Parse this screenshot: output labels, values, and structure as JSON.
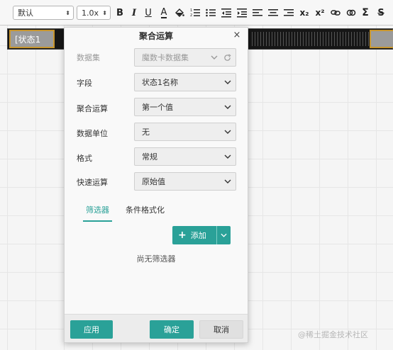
{
  "toolbar": {
    "font_value": "默认",
    "size_value": "1.0x",
    "buttons": [
      "bold",
      "italic",
      "underline",
      "font-color",
      "fill-color",
      "ordered-list",
      "unordered-list",
      "outdent",
      "indent",
      "align-left",
      "align-center",
      "align-right",
      "subscript",
      "superscript",
      "link",
      "sum",
      "strikethrough"
    ],
    "sub_label": "x₂",
    "sup_label": "x²",
    "sum_label": "Σ"
  },
  "cell": {
    "label": "[状态1"
  },
  "dialog": {
    "title": "聚合运算",
    "close_label": "×",
    "fields": {
      "dataset": {
        "label": "数据集",
        "value": "魔数卡数据集",
        "disabled": true
      },
      "field": {
        "label": "字段",
        "value": "状态1名称"
      },
      "aggregate": {
        "label": "聚合运算",
        "value": "第一个值"
      },
      "unit": {
        "label": "数据单位",
        "value": "无"
      },
      "format": {
        "label": "格式",
        "value": "常规"
      },
      "quick": {
        "label": "快速运算",
        "value": "原始值"
      }
    },
    "tabs": [
      {
        "label": "筛选器",
        "active": true
      },
      {
        "label": "条件格式化",
        "active": false
      }
    ],
    "add_button": "添加",
    "empty_text": "尚无筛选器",
    "footer": {
      "apply": "应用",
      "confirm": "确定",
      "cancel": "取消"
    }
  },
  "watermark": "@稀土掘金技术社区",
  "colors": {
    "accent": "#2aa198",
    "cell_border": "#c8962e"
  }
}
